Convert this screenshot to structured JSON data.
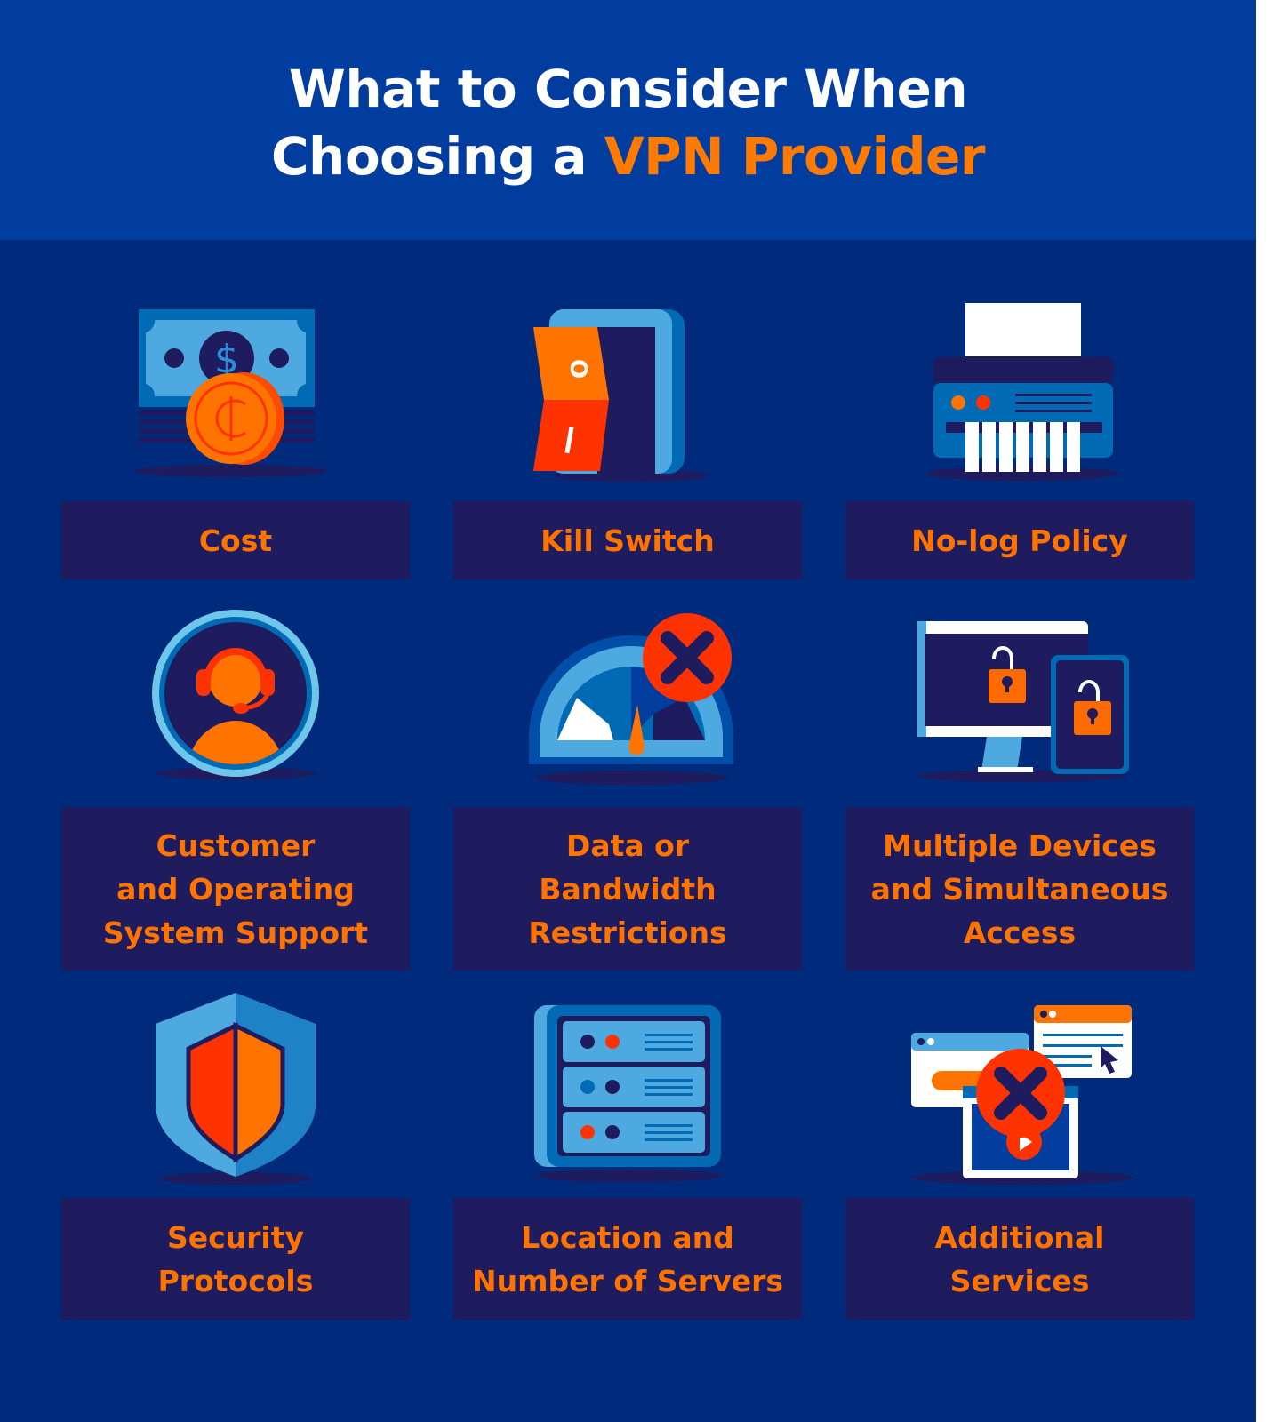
{
  "title": {
    "line1": "What to Consider When",
    "line2_prefix": "Choosing a ",
    "line2_accent": "VPN Provider"
  },
  "colors": {
    "background": "#002a7c",
    "header": "#003d9e",
    "label_box": "#1e1b5e",
    "label_text": "#ff7400",
    "accent": "#ff7a00",
    "red": "#ff3300",
    "light_blue": "#4da9e0",
    "mid_blue": "#006ab4",
    "navy": "#1e1b5e"
  },
  "items": [
    {
      "label": "Cost",
      "icon": "money-coin-icon"
    },
    {
      "label": "Kill Switch",
      "icon": "rocker-switch-icon"
    },
    {
      "label": "No-log Policy",
      "icon": "paper-shredder-icon"
    },
    {
      "label": "Customer\nand Operating\nSystem Support",
      "icon": "support-agent-headset-icon"
    },
    {
      "label": "Data or\nBandwidth\nRestrictions",
      "icon": "speedometer-blocked-icon"
    },
    {
      "label": "Multiple Devices\nand Simultaneous\nAccess",
      "icon": "locked-devices-icon"
    },
    {
      "label": "Security\nProtocols",
      "icon": "shield-icon"
    },
    {
      "label": "Location and\nNumber of Servers",
      "icon": "server-rack-icon"
    },
    {
      "label": "Additional\nServices",
      "icon": "blocked-windows-icon"
    }
  ],
  "switch_marks": {
    "off": "O",
    "on": "I"
  }
}
